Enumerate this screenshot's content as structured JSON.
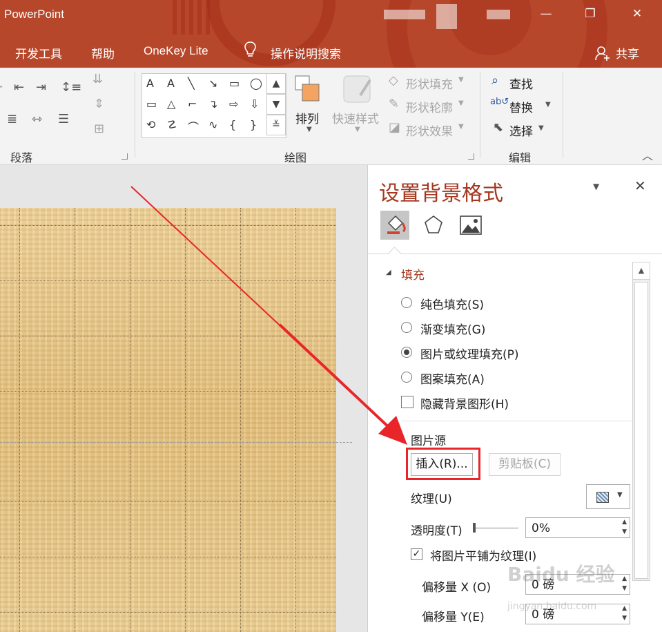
{
  "window": {
    "app_title": "PowerPoint",
    "minimize": "—",
    "restore": "❐",
    "close": "✕"
  },
  "menu": {
    "items": [
      "开发工具",
      "帮助",
      "OneKey Lite"
    ],
    "tell_me": "操作说明搜索",
    "share": "共享"
  },
  "ribbon": {
    "groups": {
      "paragraph": "段落",
      "drawing": "绘图",
      "editing": "编辑"
    },
    "arrange": "排列",
    "quick_styles": "快速样式",
    "shape_fill": "形状填充",
    "shape_outline": "形状轮廓",
    "shape_effects": "形状效果",
    "find": "查找",
    "replace": "替换",
    "select": "选择",
    "shapes": [
      "A",
      "A",
      "╲",
      "↘",
      "▭",
      "◯",
      "▭",
      "△",
      "⌐",
      "↴",
      "⇨",
      "⇩",
      "⟲",
      "☡",
      "⌒",
      "∿",
      "{",
      "}"
    ]
  },
  "pane": {
    "title": "设置背景格式",
    "section_fill": "填充",
    "options": [
      {
        "label": "纯色填充(S)",
        "selected": false
      },
      {
        "label": "渐变填充(G)",
        "selected": false
      },
      {
        "label": "图片或纹理填充(P)",
        "selected": true
      },
      {
        "label": "图案填充(A)",
        "selected": false
      }
    ],
    "hide_bg": {
      "label": "隐藏背景图形(H)",
      "checked": false
    },
    "picture_source": "图片源",
    "insert_btn": "插入(R)...",
    "clipboard_btn": "剪贴板(C)",
    "texture": "纹理(U)",
    "transparency": "透明度(T)",
    "transparency_value": "0%",
    "tile": {
      "label": "将图片平铺为纹理(I)",
      "checked": true
    },
    "offset_x": "偏移量 X (O)",
    "offset_x_value": "0 磅",
    "offset_y": "偏移量 Y(E)",
    "offset_y_value": "0 磅"
  },
  "watermark": {
    "text": "Baidu 经验",
    "sub": "jingyan.baidu.com"
  },
  "colors": {
    "accent": "#b7472a",
    "highlight": "#e8262a"
  }
}
